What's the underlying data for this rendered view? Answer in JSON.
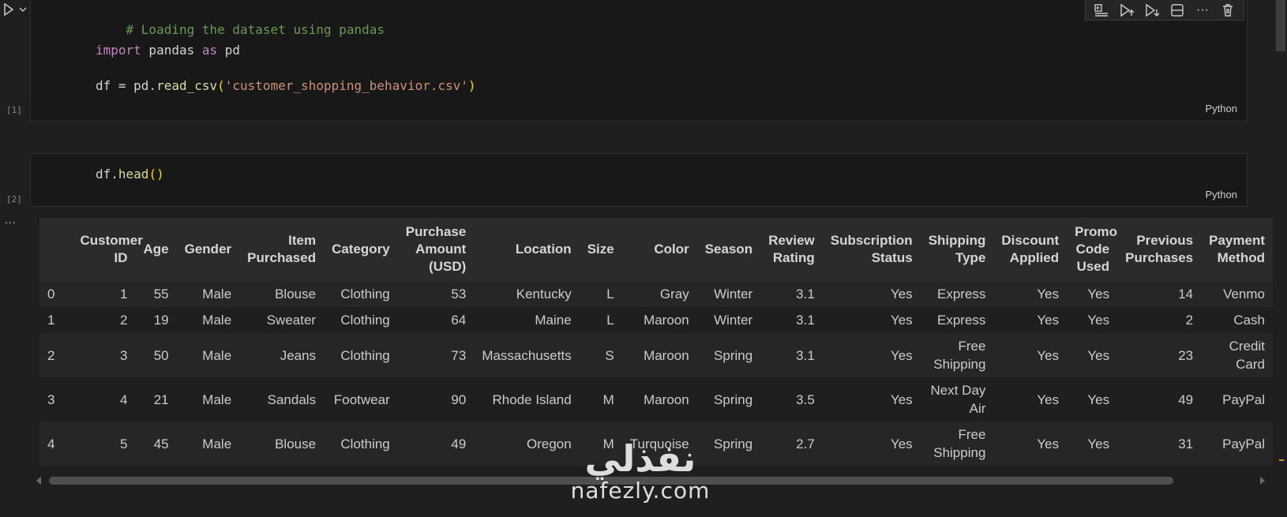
{
  "cells": [
    {
      "exec_count": "[1]",
      "language": "Python",
      "lines": {
        "comment": "# Loading the dataset using pandas",
        "import_kw": "import",
        "import_mod": " pandas ",
        "as_kw": "as",
        "import_alias": " pd",
        "assign_prefix": "df = pd.",
        "read_fn": "read_csv",
        "paren_open": "(",
        "filename": "'customer_shopping_behavior.csv'",
        "paren_close": ")"
      }
    },
    {
      "exec_count": "[2]",
      "language": "Python",
      "lines": {
        "obj": "df.",
        "fn": "head",
        "parens": "()"
      }
    }
  ],
  "output": {
    "ellipsis": "...",
    "columns": [
      "",
      "Customer ID",
      "Age",
      "Gender",
      "Item Purchased",
      "Category",
      "Purchase Amount (USD)",
      "Location",
      "Size",
      "Color",
      "Season",
      "Review Rating",
      "Subscription Status",
      "Shipping Type",
      "Discount Applied",
      "Promo Code Used",
      "Previous Purchases",
      "Payment Method"
    ],
    "rows": [
      [
        "0",
        "1",
        "55",
        "Male",
        "Blouse",
        "Clothing",
        "53",
        "Kentucky",
        "L",
        "Gray",
        "Winter",
        "3.1",
        "Yes",
        "Express",
        "Yes",
        "Yes",
        "14",
        "Venmo"
      ],
      [
        "1",
        "2",
        "19",
        "Male",
        "Sweater",
        "Clothing",
        "64",
        "Maine",
        "L",
        "Maroon",
        "Winter",
        "3.1",
        "Yes",
        "Express",
        "Yes",
        "Yes",
        "2",
        "Cash"
      ],
      [
        "2",
        "3",
        "50",
        "Male",
        "Jeans",
        "Clothing",
        "73",
        "Massachusetts",
        "S",
        "Maroon",
        "Spring",
        "3.1",
        "Yes",
        "Free Shipping",
        "Yes",
        "Yes",
        "23",
        "Credit Card"
      ],
      [
        "3",
        "4",
        "21",
        "Male",
        "Sandals",
        "Footwear",
        "90",
        "Rhode Island",
        "M",
        "Maroon",
        "Spring",
        "3.5",
        "Yes",
        "Next Day Air",
        "Yes",
        "Yes",
        "49",
        "PayPal"
      ],
      [
        "4",
        "5",
        "45",
        "Male",
        "Blouse",
        "Clothing",
        "49",
        "Oregon",
        "M",
        "Turquoise",
        "Spring",
        "2.7",
        "Yes",
        "Free Shipping",
        "Yes",
        "Yes",
        "31",
        "PayPal"
      ]
    ]
  },
  "toolbar": {
    "icons": [
      "run-by-line-icon",
      "execute-above-icon",
      "execute-below-icon",
      "split-cell-icon",
      "more-actions-icon",
      "delete-cell-icon"
    ],
    "more_glyph": "···"
  },
  "watermark": {
    "arabic": "نفذلي",
    "latin": "nafezly.com"
  },
  "colors": {
    "background": "#1f1f1f",
    "cell_background": "#181818",
    "comment": "#6a9955",
    "keyword": "#c586c0",
    "string": "#ce9178",
    "function": "#dcdcaa",
    "bracket": "#ffd700",
    "table_header": "#2b2b2b"
  }
}
